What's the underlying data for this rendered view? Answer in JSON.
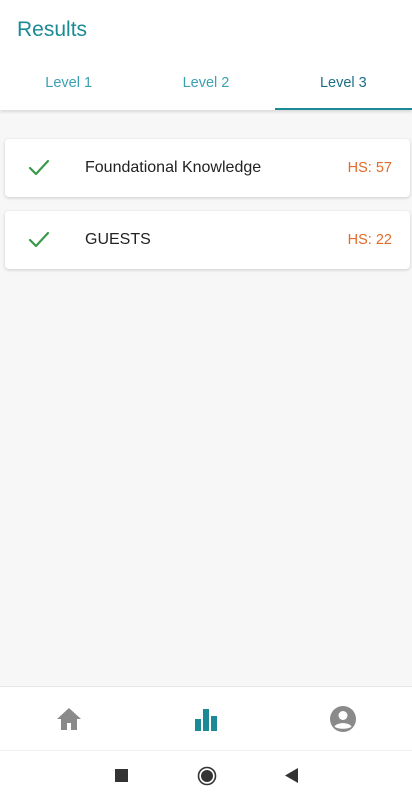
{
  "header": {
    "title": "Results"
  },
  "tabs": [
    {
      "label": "Level 1",
      "active": false
    },
    {
      "label": "Level 2",
      "active": false
    },
    {
      "label": "Level 3",
      "active": true
    }
  ],
  "results": [
    {
      "title": "Foundational Knowledge",
      "score": "HS: 57",
      "status": "check-icon"
    },
    {
      "title": "GUESTS",
      "score": "HS: 22",
      "status": "check-icon"
    }
  ],
  "bottom_nav": [
    {
      "icon": "home-icon",
      "active": false
    },
    {
      "icon": "bar-chart-icon",
      "active": true
    },
    {
      "icon": "account-icon",
      "active": false
    }
  ],
  "system_nav": [
    {
      "icon": "recents-square-icon"
    },
    {
      "icon": "home-circle-icon"
    },
    {
      "icon": "back-triangle-icon"
    }
  ],
  "colors": {
    "accent": "#1b8a96",
    "tab_inactive": "#3aa0b2",
    "check": "#3a9a4a",
    "score": "#e06b2a",
    "nav_inactive": "#8a8a8a"
  }
}
